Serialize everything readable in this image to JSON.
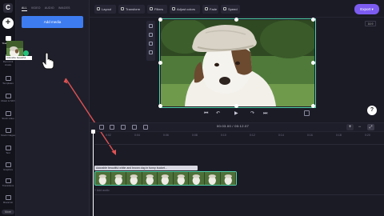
{
  "app": {
    "logo": "C"
  },
  "rail": {
    "add": "+",
    "items": [
      {
        "label": "Your media",
        "icon": "folder-icon",
        "active": true
      },
      {
        "label": "Record & create",
        "icon": "camera-icon"
      },
      {
        "label": "Templates",
        "icon": "template-icon"
      },
      {
        "label": "Music & SFX",
        "icon": "music-icon"
      },
      {
        "label": "Stock video",
        "icon": "film-icon"
      },
      {
        "label": "Stock images",
        "icon": "image-icon"
      },
      {
        "label": "Text",
        "icon": "text-icon"
      },
      {
        "label": "Graphics",
        "icon": "shapes-icon"
      },
      {
        "label": "Transitions",
        "icon": "transition-icon"
      },
      {
        "label": "Brand kit",
        "icon": "brand-icon"
      }
    ],
    "more": "More"
  },
  "media": {
    "tabs": [
      "ALL",
      "VIDEO",
      "AUDIO",
      "IMAGES"
    ],
    "add_button": "Add media",
    "thumb_label": "Adorable beautiful"
  },
  "toolbar": {
    "buttons": [
      "Layout",
      "Transform",
      "Filters",
      "Adjust colors",
      "Fade",
      "Speed"
    ],
    "export": "Export"
  },
  "preview": {
    "aspect": "16:9"
  },
  "timeline": {
    "timecode": "00:03.00 / 00:12.07",
    "ruler": [
      "0:02",
      "0:04",
      "0:06",
      "0:08",
      "0:10",
      "0:12",
      "0:14",
      "0:16",
      "0:18",
      "0:20",
      "0:22",
      "0:24"
    ],
    "clip_label": "Adorable beautiful white and brown dog in funny bucket...",
    "audio_hint": "+ Add audio"
  },
  "colors": {
    "accent": "#7c5cf0",
    "primary": "#3d7cf0",
    "selection": "#4fd1a8",
    "arrow": "#e05353"
  }
}
